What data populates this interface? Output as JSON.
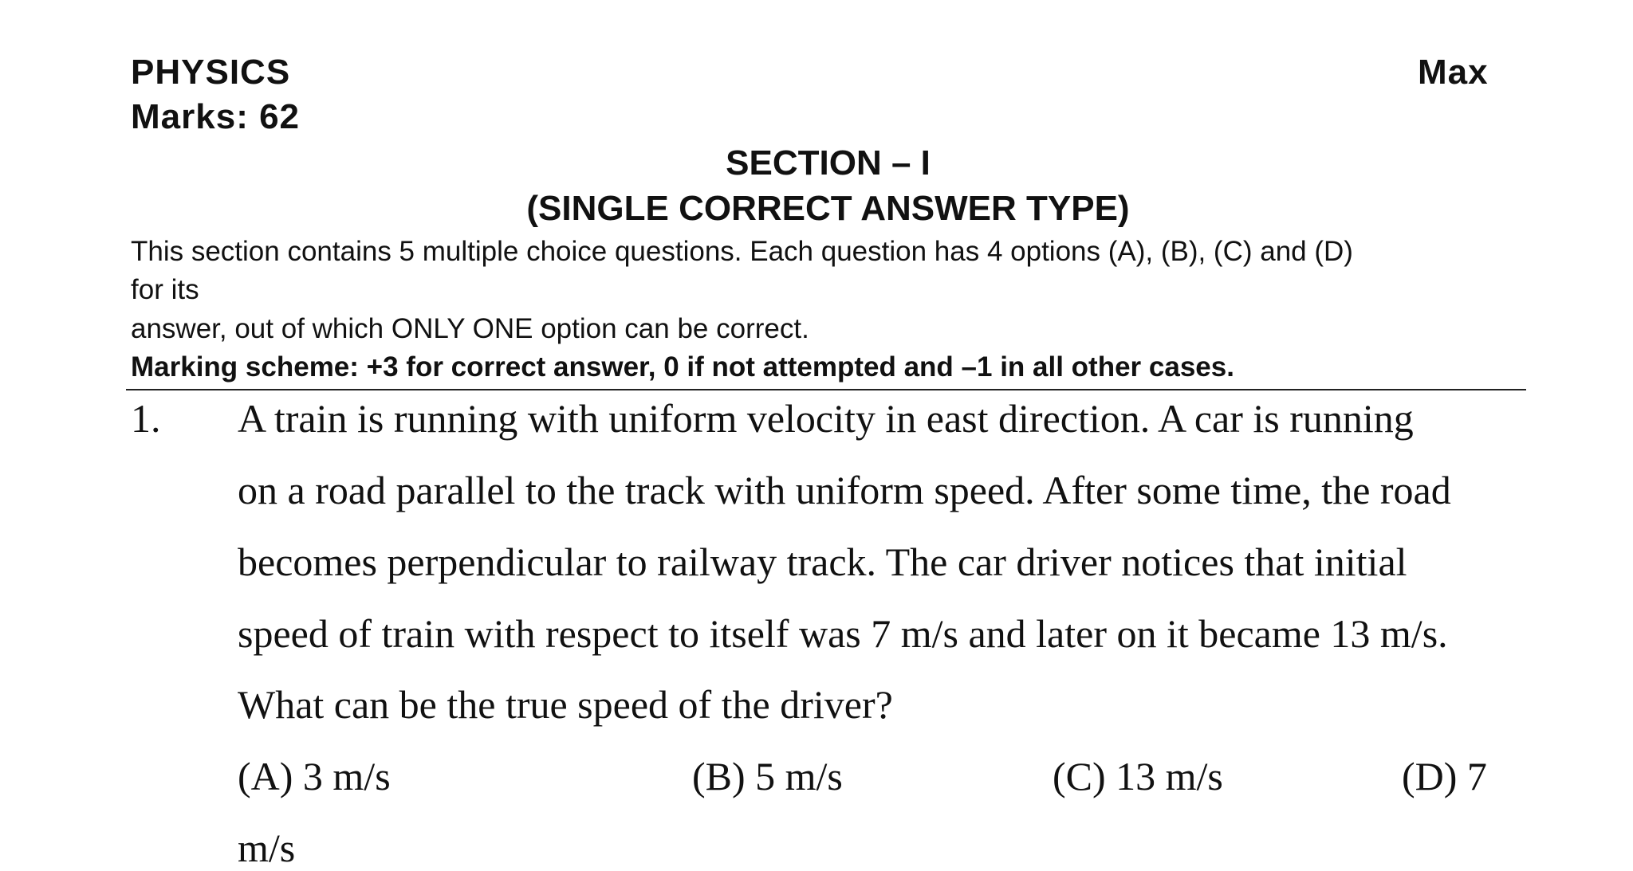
{
  "header": {
    "subject": "PHYSICS",
    "max_label": "Max",
    "marks_line": "Marks: 62"
  },
  "section": {
    "title": "SECTION – I",
    "type": "(SINGLE CORRECT ANSWER TYPE)",
    "instructions": [
      "This section contains 5 multiple choice questions. Each question has 4 options (A), (B), (C) and (D)",
      "for its",
      "answer, out of which ONLY ONE option can be correct."
    ],
    "marking_scheme": "Marking scheme: +3 for correct answer, 0 if not attempted and –1 in all other cases."
  },
  "question": {
    "number": "1.",
    "lines": [
      "A train is running with uniform velocity in east direction. A car is running",
      "on a road parallel to the track with uniform speed. After some time, the road",
      "becomes perpendicular to railway track. The car driver notices that initial",
      "speed of train with respect to itself was 7 m/s and later on it became 13 m/s.",
      "What can be the true speed of the driver?"
    ],
    "options": {
      "a": "(A) 3 m/s",
      "b": "(B) 5 m/s",
      "c": "(C) 13 m/s",
      "d": "(D) 7",
      "d_continued": "m/s"
    }
  }
}
